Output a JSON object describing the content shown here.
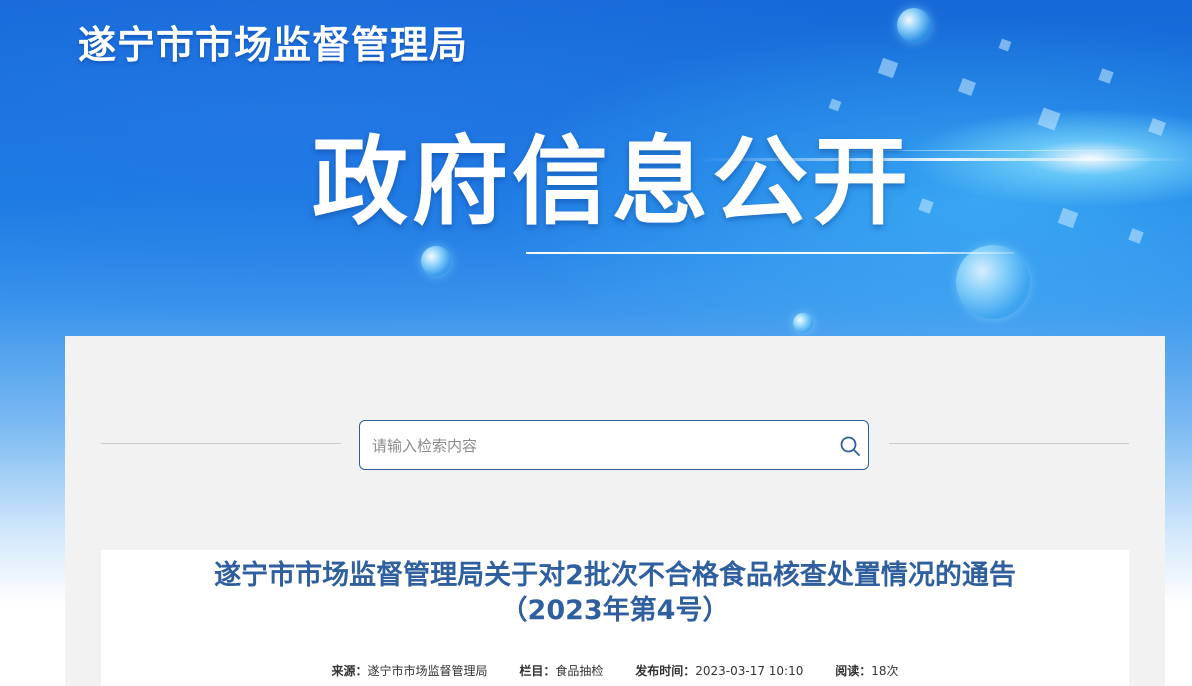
{
  "header": {
    "site_name": "遂宁市市场监督管理局",
    "section_title": "政府信息公开"
  },
  "search": {
    "placeholder": "请输入检索内容",
    "value": ""
  },
  "article": {
    "title_line1": "遂宁市市场监督管理局关于对2批次不合格食品核查处置情况的通告",
    "title_line2": "（2023年第4号）",
    "meta": {
      "source_label": "来源：",
      "source_value": "遂宁市市场监督管理局",
      "column_label": "栏目：",
      "column_value": "食品抽检",
      "published_label": "发布时间：",
      "published_value": "2023-03-17 10:10",
      "reads_label": "阅读：",
      "reads_value": "18次"
    }
  },
  "icons": {
    "search": "search-icon"
  },
  "colors": {
    "title_blue": "#2f5f9e",
    "search_border": "#2f5f99",
    "panel_bg": "#f2f2f2"
  }
}
